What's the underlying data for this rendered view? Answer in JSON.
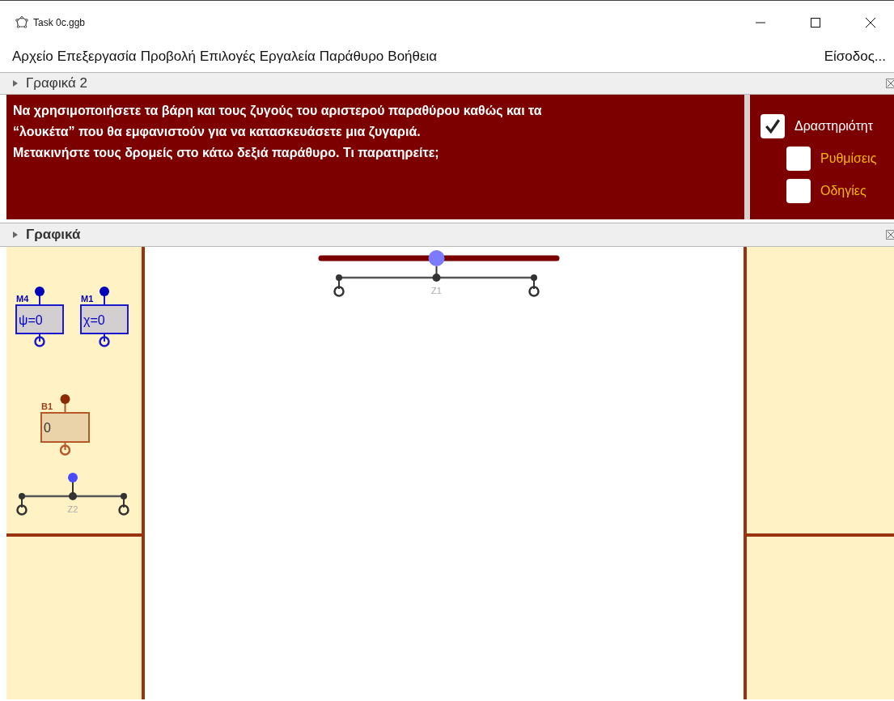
{
  "window": {
    "title": "Task 0c.ggb"
  },
  "menu": [
    "Αρχείο",
    "Επεξεργασία",
    "Προβολή",
    "Επιλογές",
    "Εργαλεία",
    "Παράθυρο",
    "Βοήθεια"
  ],
  "login": "Είσοδος...",
  "graphics2": {
    "title": "Γραφικά 2",
    "lines": [
      "Να χρησιμοποιήσετε τα βάρη και τους ζυγούς του αριστερού παραθύρου καθώς και τα",
      "“λουκέτα” που θα εμφανιστούν για να κατασκευάσετε μια ζυγαριά.",
      "Μετακινήστε τους δρομείς στο κάτω δεξιά παράθυρο. Τι παρατηρείτε;"
    ],
    "checkboxes": [
      {
        "label": "Δραστηριότητ",
        "checked": true,
        "kind": "main"
      },
      {
        "label": "Ρυθμίσεις",
        "checked": false,
        "kind": "sub"
      },
      {
        "label": "Οδηγίες",
        "checked": false,
        "kind": "sub"
      }
    ]
  },
  "graphics": {
    "title": "Γραφικά",
    "blocks": [
      {
        "label": "M4",
        "value": "ψ=0",
        "kind": "weight"
      },
      {
        "label": "M1",
        "value": "χ=0",
        "kind": "weight"
      },
      {
        "label": "B1",
        "value": "0",
        "kind": "input"
      }
    ],
    "balances": [
      {
        "label": "Z2"
      },
      {
        "label": "Z1"
      }
    ],
    "slider": {
      "level": 0.49
    }
  }
}
